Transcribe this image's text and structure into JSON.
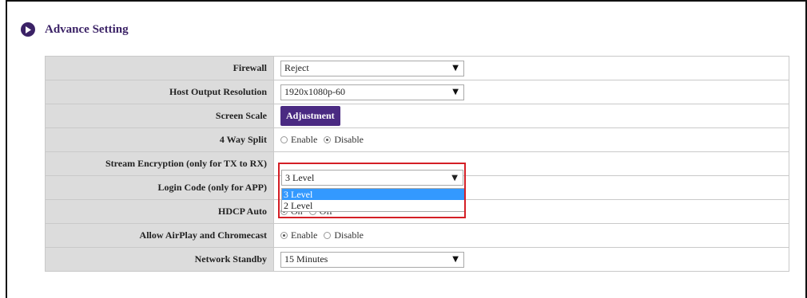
{
  "section": {
    "title": "Advance Setting",
    "icon": "play-circle-icon"
  },
  "rows": [
    {
      "label": "Firewall",
      "type": "select",
      "value": "Reject"
    },
    {
      "label": "Host Output Resolution",
      "type": "select",
      "value": "1920x1080p-60"
    },
    {
      "label": "Screen Scale",
      "type": "button",
      "button_label": "Adjustment"
    },
    {
      "label": "4 Way Split",
      "type": "radio",
      "options": [
        "Enable",
        "Disable"
      ],
      "selected": "Disable"
    },
    {
      "label": "Stream Encryption (only for TX to RX)",
      "type": "select",
      "value": "3 Level",
      "dropdown_open": true,
      "options": [
        "3 Level",
        "2 Level"
      ],
      "highlighted": "3 Level"
    },
    {
      "label": "Login Code (only for APP)",
      "type": "select",
      "value": ""
    },
    {
      "label": "HDCP Auto",
      "type": "radio",
      "options": [
        "On",
        "Off"
      ],
      "selected": "On"
    },
    {
      "label": "Allow AirPlay and Chromecast",
      "type": "radio",
      "options": [
        "Enable",
        "Disable"
      ],
      "selected": "Enable"
    },
    {
      "label": "Network Standby",
      "type": "select",
      "value": "15 Minutes"
    }
  ],
  "colors": {
    "accent": "#4a2a82",
    "label_bg": "#dcdcdc",
    "highlight_border": "#d41f26",
    "selection": "#3399ff"
  }
}
